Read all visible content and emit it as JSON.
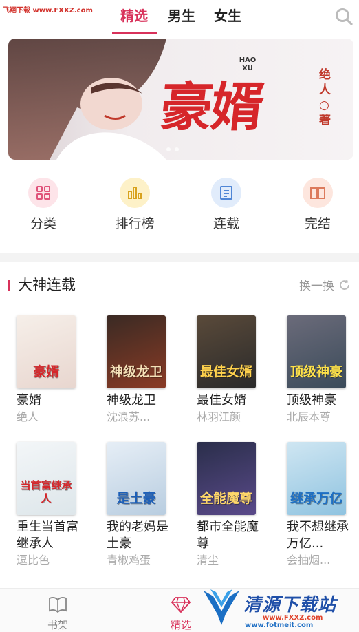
{
  "watermark_top": "飞翔下载 www.FXXZ.com",
  "tabs": [
    {
      "label": "精选"
    },
    {
      "label": "男生"
    },
    {
      "label": "女生"
    }
  ],
  "banner": {
    "title": "豪婿",
    "pinyin": "HAO XU",
    "author_line": "绝人○著"
  },
  "quick_nav": [
    {
      "label": "分类",
      "icon": "grid-icon",
      "bg": "#fde4e9",
      "color": "#e0527a"
    },
    {
      "label": "排行榜",
      "icon": "bar-chart-icon",
      "bg": "#fdf1c8",
      "color": "#d8a21e"
    },
    {
      "label": "连载",
      "icon": "document-icon",
      "bg": "#e1ecfb",
      "color": "#4f86d6"
    },
    {
      "label": "完结",
      "icon": "book-icon",
      "bg": "#fde6de",
      "color": "#dc7a5c"
    }
  ],
  "section": {
    "title": "大神连载",
    "refresh": "换一换"
  },
  "books": [
    {
      "title": "豪婿",
      "author": "绝人",
      "cover_text": "豪婿",
      "c1": "#f6efe9",
      "c2": "#e8d6cf",
      "tc": "#d6262a"
    },
    {
      "title": "神级龙卫",
      "author": "沈浪苏...",
      "cover_text": "神级龙卫",
      "c1": "#3a2a24",
      "c2": "#8a3b25",
      "tc": "#f4e1b8"
    },
    {
      "title": "最佳女婿",
      "author": "林羽江颜",
      "cover_text": "最佳女婿",
      "c1": "#5a4a3a",
      "c2": "#2a2a2a",
      "tc": "#ffd24d"
    },
    {
      "title": "顶级神豪",
      "author": "北辰本尊",
      "cover_text": "顶级神豪",
      "c1": "#6b6b7a",
      "c2": "#3b4b5a",
      "tc": "#ffe24a"
    },
    {
      "title": "重生当首富继承人",
      "author": "逗比色",
      "cover_text": "当首富继承人",
      "c1": "#f3f6f8",
      "c2": "#dde6ea",
      "tc": "#d6262a"
    },
    {
      "title": "我的老妈是土豪",
      "author": "青椒鸡蛋",
      "cover_text": "是土豪",
      "c1": "#e6eef6",
      "c2": "#b8cde0",
      "tc": "#1c5fb8"
    },
    {
      "title": "都市全能魔尊",
      "author": "清尘",
      "cover_text": "全能魔尊",
      "c1": "#2a2e4a",
      "c2": "#5a4a8a",
      "tc": "#ffd86a"
    },
    {
      "title": "我不想继承万亿...",
      "author": "会抽烟...",
      "cover_text": "继承万亿",
      "c1": "#cfe6f2",
      "c2": "#8fc3e0",
      "tc": "#1d6fc4"
    }
  ],
  "bottom_nav": [
    {
      "label": "书架",
      "icon": "bookshelf-icon"
    },
    {
      "label": "精选",
      "icon": "diamond-icon"
    }
  ],
  "watermark_bottom": {
    "brand": "清源下载站",
    "url": "www.FXXZ.com",
    "url2": "www.fotmeit.com"
  },
  "colors": {
    "accent": "#d8315a"
  }
}
